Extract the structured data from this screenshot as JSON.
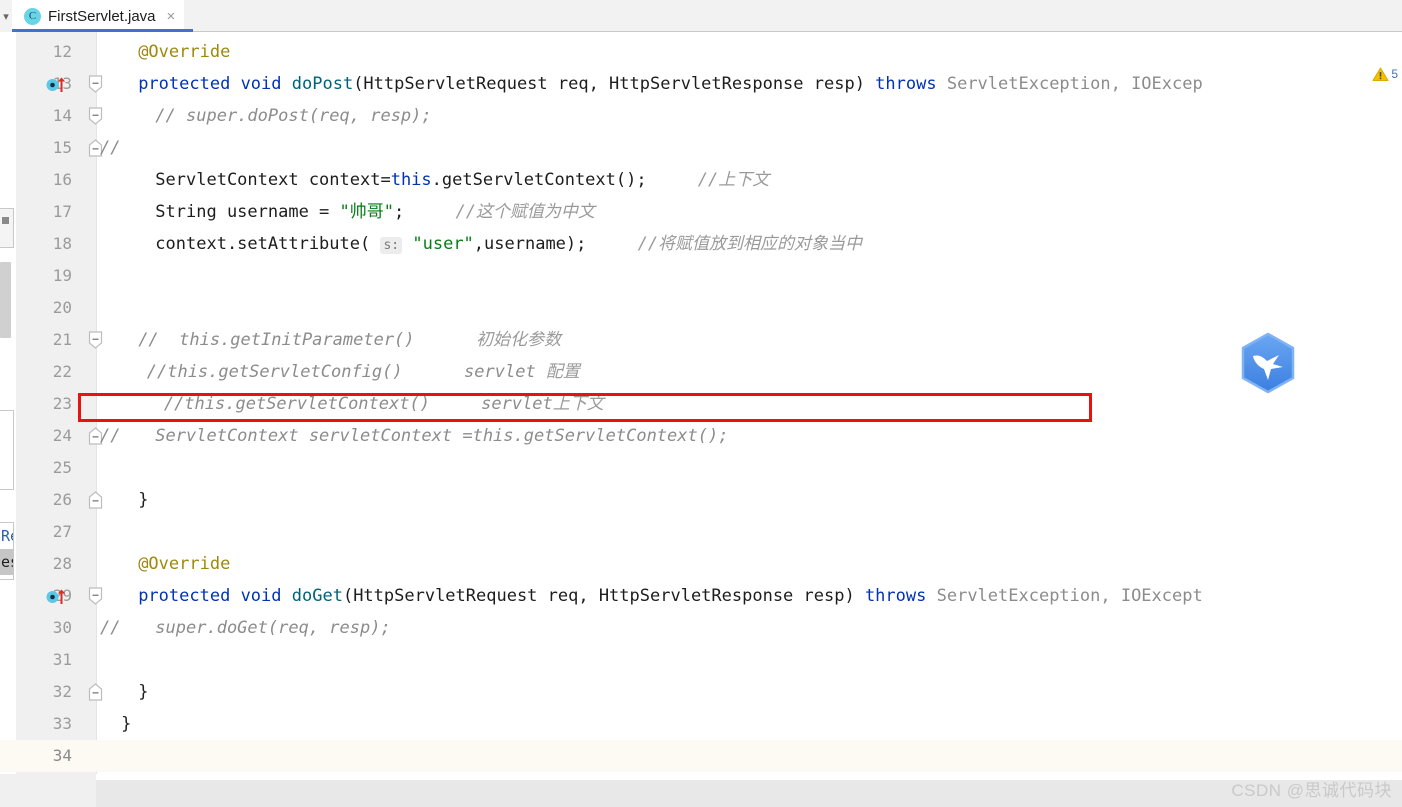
{
  "window": {
    "app": "IntelliJ IDEA Editor",
    "theme_background": "#ffffff"
  },
  "tabbar": {
    "tab_label": "FirstServlet.java",
    "tab_icon_letter": "C",
    "tab_icon_name": "java-class-icon",
    "close_glyph": "×",
    "left_stub_glyph": "▾",
    "accent_color": "#3d74c9"
  },
  "inspection": {
    "warning_icon_name": "warning-triangle-icon",
    "warning_color": "#f2c200",
    "count_label": "5"
  },
  "editor": {
    "first_line": 12,
    "caret_line": 34,
    "lines": [
      {
        "no": "12",
        "gutter_fold": "none",
        "gutter_marker": "none",
        "gutter_comment": "",
        "indent": 4,
        "text": "@Override",
        "tokens": [
          {
            "t": "@Override",
            "c": "anno"
          }
        ]
      },
      {
        "no": "13",
        "gutter_fold": "fold-start",
        "gutter_marker": "override-method",
        "gutter_comment": "",
        "indent": 4,
        "text": "protected void doPost(HttpServletRequest req, HttpServletResponse resp) throws ServletException, IOExcep",
        "tokens": [
          {
            "t": "protected",
            "c": "kw"
          },
          {
            "t": " ",
            "c": "plain"
          },
          {
            "t": "void",
            "c": "kw"
          },
          {
            "t": " ",
            "c": "plain"
          },
          {
            "t": "doPost",
            "c": "meth"
          },
          {
            "t": "(HttpServletRequest req, HttpServletResponse resp) ",
            "c": "plain"
          },
          {
            "t": "throws",
            "c": "kw"
          },
          {
            "t": " ",
            "c": "plain"
          },
          {
            "t": "ServletException, IOExcep",
            "c": "cls"
          }
        ]
      },
      {
        "no": "14",
        "gutter_fold": "fold-mid",
        "gutter_marker": "none",
        "gutter_comment": "",
        "indent": 6,
        "text": "// super.doPost(req, resp);",
        "tokens": [
          {
            "t": "// super.doPost(req, resp);",
            "c": "cmt"
          }
        ]
      },
      {
        "no": "15",
        "gutter_fold": "fold-end",
        "gutter_marker": "none",
        "gutter_comment": "//",
        "indent": 0,
        "text": "",
        "tokens": []
      },
      {
        "no": "16",
        "gutter_fold": "none",
        "gutter_marker": "none",
        "gutter_comment": "",
        "indent": 6,
        "text": "ServletContext context=this.getServletContext();    //上下文",
        "tokens": [
          {
            "t": "ServletContext context=",
            "c": "plain"
          },
          {
            "t": "this",
            "c": "kw"
          },
          {
            "t": ".getServletContext();",
            "c": "plain"
          },
          {
            "t": "     ",
            "c": "plain"
          },
          {
            "t": "//上下文",
            "c": "cmt-cn"
          }
        ]
      },
      {
        "no": "17",
        "gutter_fold": "none",
        "gutter_marker": "none",
        "gutter_comment": "",
        "indent": 6,
        "text": "String username = \"帅哥\";    //这个赋值为中文",
        "tokens": [
          {
            "t": "String username = ",
            "c": "plain"
          },
          {
            "t": "\"帅哥\"",
            "c": "str"
          },
          {
            "t": ";",
            "c": "plain"
          },
          {
            "t": "     ",
            "c": "plain"
          },
          {
            "t": "//这个赋值为中文",
            "c": "cmt-cn"
          }
        ]
      },
      {
        "no": "18",
        "gutter_fold": "none",
        "gutter_marker": "none",
        "gutter_comment": "",
        "indent": 6,
        "text": "context.setAttribute( s: \"user\",username);    //将赋值放到相应的对象当中",
        "param_hint": "s:",
        "tokens": [
          {
            "t": "context.setAttribute( ",
            "c": "plain"
          },
          {
            "t": "s:",
            "c": "hintchip"
          },
          {
            "t": " ",
            "c": "plain"
          },
          {
            "t": "\"user\"",
            "c": "str"
          },
          {
            "t": ",username);",
            "c": "plain"
          },
          {
            "t": "     ",
            "c": "plain"
          },
          {
            "t": "//将赋值放到相应的对象当中",
            "c": "cmt-cn"
          }
        ]
      },
      {
        "no": "19",
        "gutter_fold": "none",
        "gutter_marker": "none",
        "gutter_comment": "",
        "indent": 0,
        "text": "",
        "tokens": []
      },
      {
        "no": "20",
        "gutter_fold": "none",
        "gutter_marker": "none",
        "gutter_comment": "",
        "indent": 0,
        "text": "",
        "tokens": []
      },
      {
        "no": "21",
        "gutter_fold": "fold-mid",
        "gutter_marker": "none",
        "gutter_comment": "",
        "indent": 4,
        "text": "//  this.getInitParameter()      初始化参数",
        "tokens": [
          {
            "t": "//  this.getInitParameter()",
            "c": "cmt"
          },
          {
            "t": "      ",
            "c": "cmt"
          },
          {
            "t": "初始化参数",
            "c": "cmt-cn"
          }
        ]
      },
      {
        "no": "22",
        "gutter_fold": "none",
        "gutter_marker": "none",
        "gutter_comment": "",
        "indent": 5,
        "text": "//this.getServletConfig()      servlet 配置",
        "tokens": [
          {
            "t": "//this.getServletConfig()",
            "c": "cmt"
          },
          {
            "t": "      servlet ",
            "c": "cmt"
          },
          {
            "t": "配置",
            "c": "cmt-cn"
          }
        ]
      },
      {
        "no": "23",
        "gutter_fold": "none",
        "gutter_marker": "none",
        "gutter_comment": "",
        "indent": 7,
        "highlighted": true,
        "text": "//this.getServletContext()     servlet上下文",
        "tokens": [
          {
            "t": "//this.getServletContext()",
            "c": "cmt"
          },
          {
            "t": "     servlet",
            "c": "cmt"
          },
          {
            "t": "上下文",
            "c": "cmt-cn"
          }
        ]
      },
      {
        "no": "24",
        "gutter_fold": "fold-end",
        "gutter_marker": "none",
        "gutter_comment": "//",
        "indent": 6,
        "text": "ServletContext servletContext =this.getServletContext();",
        "tokens": [
          {
            "t": "ServletContext servletContext =this.getServletContext();",
            "c": "cmt"
          }
        ]
      },
      {
        "no": "25",
        "gutter_fold": "none",
        "gutter_marker": "none",
        "gutter_comment": "",
        "indent": 0,
        "text": "",
        "tokens": []
      },
      {
        "no": "26",
        "gutter_fold": "fold-end",
        "gutter_marker": "none",
        "gutter_comment": "",
        "indent": 4,
        "text": "}",
        "tokens": [
          {
            "t": "}",
            "c": "plain"
          }
        ]
      },
      {
        "no": "27",
        "gutter_fold": "none",
        "gutter_marker": "none",
        "gutter_comment": "",
        "indent": 0,
        "text": "",
        "tokens": []
      },
      {
        "no": "28",
        "gutter_fold": "none",
        "gutter_marker": "none",
        "gutter_comment": "",
        "indent": 4,
        "text": "@Override",
        "tokens": [
          {
            "t": "@Override",
            "c": "anno"
          }
        ]
      },
      {
        "no": "29",
        "gutter_fold": "fold-start",
        "gutter_marker": "override-method",
        "gutter_comment": "",
        "indent": 4,
        "text": "protected void doGet(HttpServletRequest req, HttpServletResponse resp) throws ServletException, IOExcept",
        "tokens": [
          {
            "t": "protected",
            "c": "kw"
          },
          {
            "t": " ",
            "c": "plain"
          },
          {
            "t": "void",
            "c": "kw"
          },
          {
            "t": " ",
            "c": "plain"
          },
          {
            "t": "doGet",
            "c": "meth"
          },
          {
            "t": "(HttpServletRequest req, HttpServletResponse resp) ",
            "c": "plain"
          },
          {
            "t": "throws",
            "c": "kw"
          },
          {
            "t": " ",
            "c": "plain"
          },
          {
            "t": "ServletException, IOExcept",
            "c": "cls"
          }
        ]
      },
      {
        "no": "30",
        "gutter_fold": "none",
        "gutter_marker": "none",
        "gutter_comment": "//",
        "indent": 6,
        "text": "super.doGet(req, resp);",
        "tokens": [
          {
            "t": "super.doGet(req, resp);",
            "c": "cmt"
          }
        ]
      },
      {
        "no": "31",
        "gutter_fold": "none",
        "gutter_marker": "none",
        "gutter_comment": "",
        "indent": 0,
        "text": "",
        "tokens": []
      },
      {
        "no": "32",
        "gutter_fold": "fold-end",
        "gutter_marker": "none",
        "gutter_comment": "",
        "indent": 4,
        "text": "}",
        "tokens": [
          {
            "t": "}",
            "c": "plain"
          }
        ]
      },
      {
        "no": "33",
        "gutter_fold": "none",
        "gutter_marker": "none",
        "gutter_comment": "",
        "indent": 2,
        "text": "}",
        "tokens": [
          {
            "t": "}",
            "c": "plain"
          }
        ]
      },
      {
        "no": "34",
        "gutter_fold": "none",
        "gutter_marker": "none",
        "gutter_comment": "",
        "indent": 0,
        "caret": true,
        "text": "",
        "tokens": []
      }
    ]
  },
  "annotation": {
    "redbox_color": "#e8120e",
    "redbox_target_line": "23",
    "redbox_target_text": "//this.getServletContext()     servlet上下文"
  },
  "floating_logo": {
    "icon_name": "blue-hexagon-bird-logo",
    "hex_color": "#4a90e8",
    "bird_color": "#ffffff"
  },
  "edge_popup": {
    "items": [
      {
        "text": "Re",
        "selected": false
      },
      {
        "text": "es",
        "selected": true
      }
    ]
  },
  "watermark": {
    "text": "CSDN @思诚代码块",
    "color": "#c9c9c9"
  }
}
